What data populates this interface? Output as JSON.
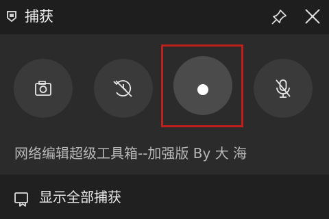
{
  "titlebar": {
    "app_icon": "capture-app-icon",
    "title": "捕获",
    "pin_icon": "pin-icon",
    "close_icon": "close-icon"
  },
  "capture": {
    "buttons": [
      {
        "name": "screenshot",
        "icon": "camera-icon"
      },
      {
        "name": "record-last",
        "icon": "rewind-clock-icon"
      },
      {
        "name": "start-recording",
        "icon": "record-dot-icon",
        "highlighted": true
      },
      {
        "name": "microphone",
        "icon": "microphone-off-icon"
      }
    ],
    "highlight_color": "#c0201b"
  },
  "tool_name": "网络编辑超级工具箱--加强版 By 大 海",
  "footer": {
    "icon": "gallery-icon",
    "link": "显示全部捕获"
  }
}
